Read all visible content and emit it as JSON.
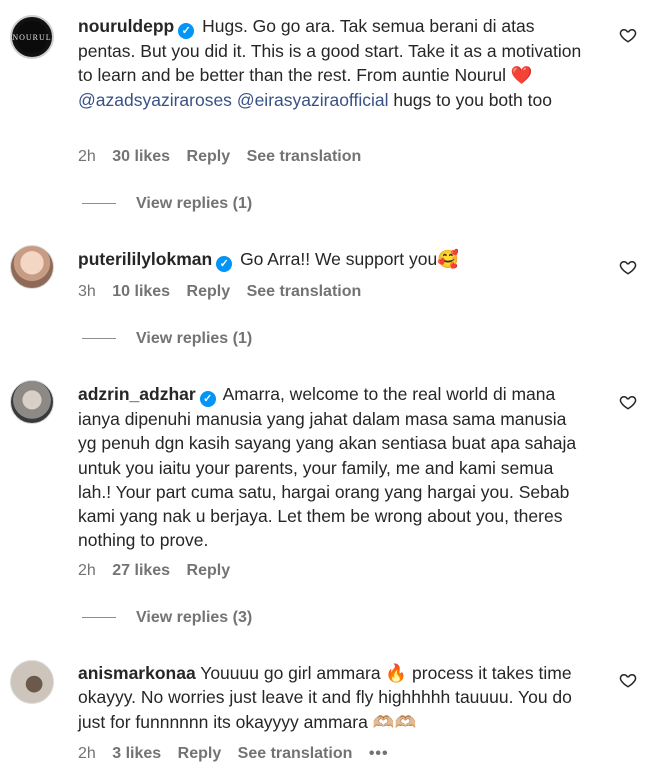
{
  "comments": [
    {
      "username": "nouruldepp",
      "avatar_text": "NOURUL",
      "text_before": " Hugs. Go go ara. Tak semua berani di atas pentas. But you did it. This is a good start. Take it as a motivation to learn and be better than the rest. From auntie Nourul ",
      "emoji": "❤️",
      "mention1": "@azadsyaziraroses",
      "mention2": "@eirasyaziraofficial",
      "text_after": " hugs to you both too",
      "time": "2h",
      "likes": "30 likes",
      "reply": "Reply",
      "translate": "See translation",
      "view_replies": "View replies (1)"
    },
    {
      "username": "puterililylokman",
      "text": " Go Arra!! We support you🥰",
      "time": "3h",
      "likes": "10 likes",
      "reply": "Reply",
      "translate": "See translation",
      "view_replies": "View replies (1)"
    },
    {
      "username": "adzrin_adzhar",
      "text": " Amarra, welcome to the real world di mana ianya dipenuhi manusia yang jahat dalam masa sama manusia yg penuh dgn kasih sayang yang akan sentiasa buat apa sahaja untuk you iaitu your parents, your family, me and kami semua lah.! Your part cuma satu, hargai orang yang hargai you. Sebab kami yang nak u berjaya. Let them be wrong about you, theres nothing to prove.",
      "time": "2h",
      "likes": "27 likes",
      "reply": "Reply",
      "view_replies": "View replies (3)"
    },
    {
      "username": "anismarkonaa",
      "text": " Youuuu go girl ammara 🔥 process it takes time okayyy. No worries just leave it and fly highhhhh tauuuu. You do just for funnnnnn its okayyyy ammara 🫶🏼🫶🏼",
      "time": "2h",
      "likes": "3 likes",
      "reply": "Reply",
      "translate": "See translation",
      "more": "•••"
    }
  ],
  "icons": {
    "verified": "verified-badge-icon",
    "like": "heart-outline-icon"
  },
  "colors": {
    "verified": "#0095f6",
    "mention": "#385185",
    "meta": "#737373",
    "text": "#262626"
  }
}
